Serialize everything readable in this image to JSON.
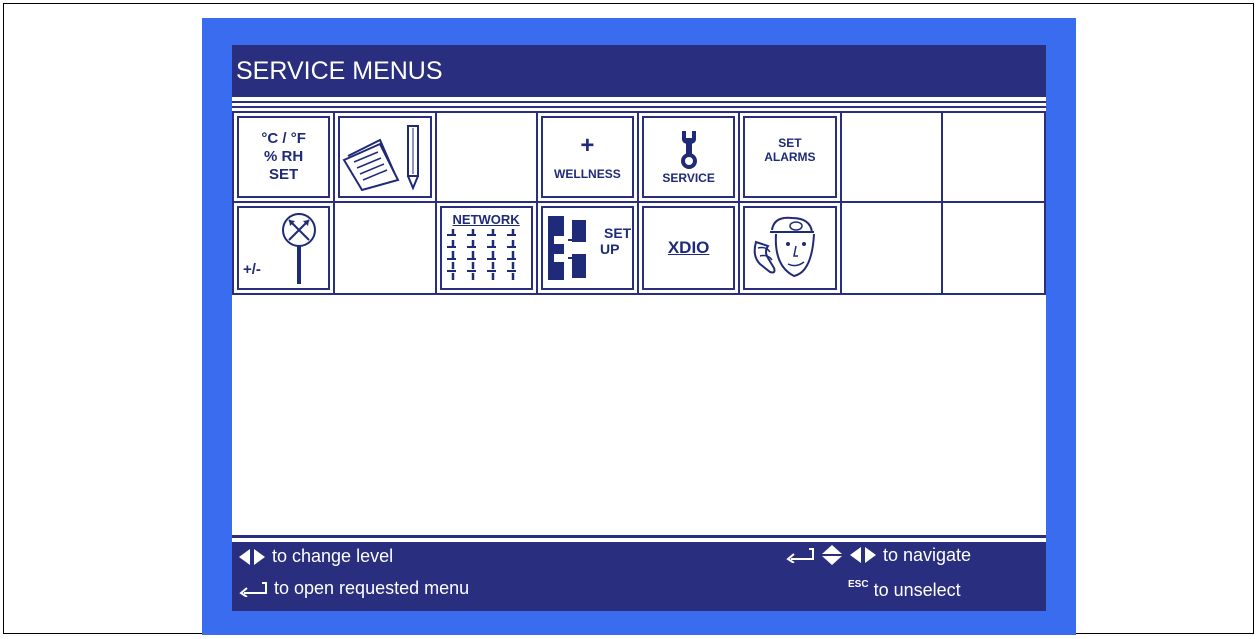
{
  "title": "SERVICE MENUS",
  "tiles": {
    "units": [
      "°C / °F",
      "% RH",
      "SET"
    ],
    "wellness": {
      "symbol": "+",
      "label": "WELLNESS"
    },
    "service": "SERVICE",
    "alarms": [
      "SET",
      "ALARMS"
    ],
    "network": "NETWORK",
    "setup": [
      "SET",
      "UP"
    ],
    "xdio": "XDIO",
    "calibrate": "+/-"
  },
  "status": {
    "change_level": "to change level",
    "open_menu": "to open requested menu",
    "navigate": "to navigate",
    "esc": "ESC",
    "unselect": "to unselect"
  },
  "colors": {
    "bezel": "#3a6cf0",
    "panel": "#2a2e7e",
    "text": "#1f2a78"
  },
  "icons": [
    "units-icon",
    "logbook-icon",
    "wellness-icon",
    "service-wrench-icon",
    "alarms-icon",
    "calibrate-icon",
    "network-icon",
    "setup-icon",
    "xdio-icon",
    "technician-icon",
    "left-right-arrows-icon",
    "enter-icon",
    "up-down-arrows-icon"
  ]
}
